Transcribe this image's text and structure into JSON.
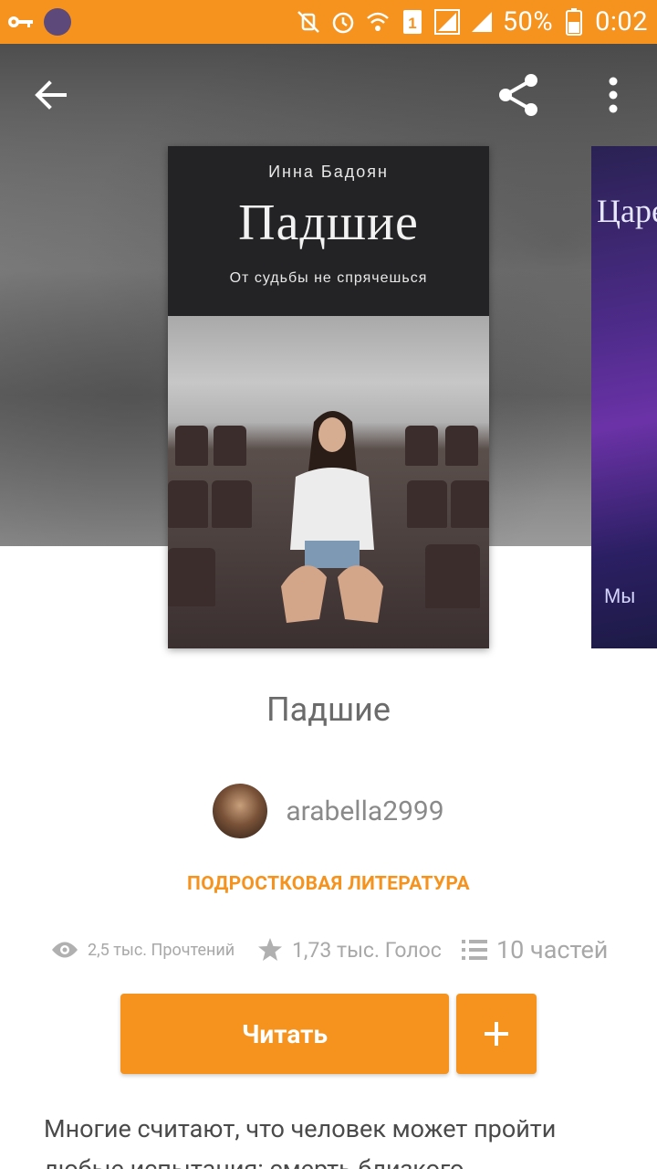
{
  "status_bar": {
    "battery_percent": "50%",
    "time": "0:02",
    "sim_slot": "1",
    "icons": [
      "key-icon",
      "app-notification-icon",
      "mute-icon",
      "alarm-icon",
      "wifi-icon",
      "sim-icon",
      "signal-icon",
      "signal-icon",
      "battery-icon"
    ]
  },
  "toolbar": {
    "back_icon": "arrow-left-icon",
    "share_icon": "share-icon",
    "more_icon": "more-vertical-icon"
  },
  "cover": {
    "author": "Инна Бадоян",
    "title": "Падшие",
    "subtitle": "От судьбы не спрячешься"
  },
  "next_cover": {
    "text_top": "Царе",
    "text_bottom": "Мы"
  },
  "book": {
    "title": "Падшие",
    "author": "arabella2999",
    "genre": "ПОДРОСТКОВАЯ ЛИТЕРАТУРА"
  },
  "stats": {
    "reads": "2,5 тыс. Прочтений",
    "votes": "1,73 тыс. Голос",
    "parts": "10 частей"
  },
  "actions": {
    "read_label": "Читать",
    "add_icon": "plus-icon"
  },
  "description": "Многие считают, что человек может пройти любые испытания: смерть близкого",
  "colors": {
    "accent": "#f5931e",
    "text_muted": "#8a8a8a"
  }
}
